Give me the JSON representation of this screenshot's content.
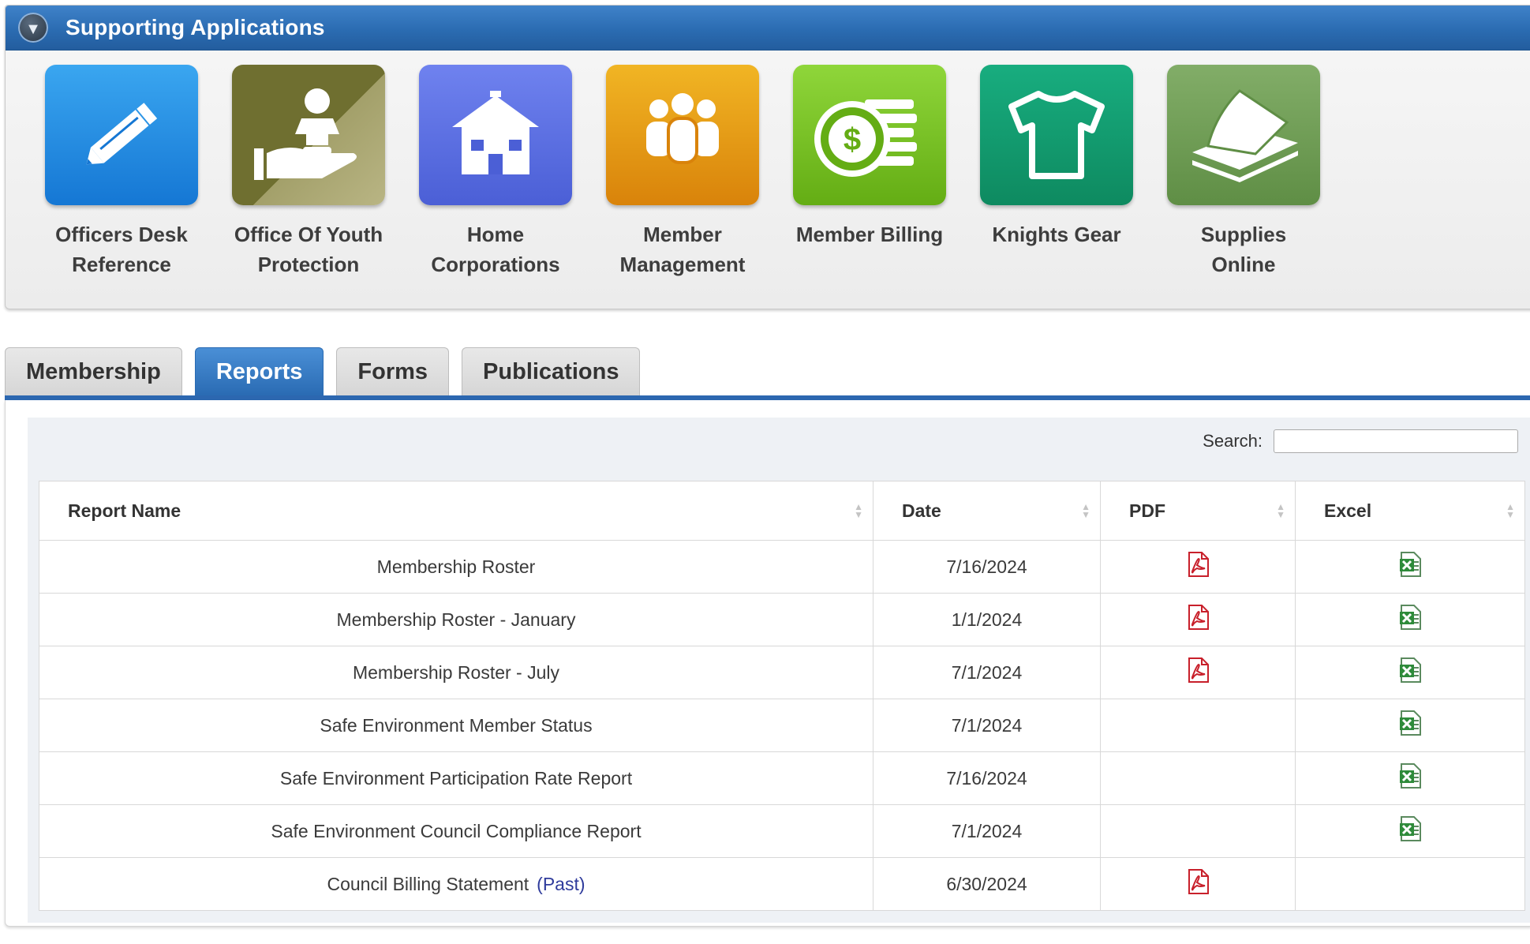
{
  "supporting_apps": {
    "title": "Supporting Applications",
    "apps": [
      {
        "line1": "Officers Desk",
        "line2": "Reference",
        "icon": "pencil-icon",
        "color": "#1e8fe6"
      },
      {
        "line1": "Office Of Youth",
        "line2": "Protection",
        "icon": "child-in-hand-icon",
        "color": "#7a7a3e"
      },
      {
        "line1": "Home",
        "line2": "Corporations",
        "icon": "house-icon",
        "color": "#5b6fe0"
      },
      {
        "line1": "Member",
        "line2": "Management",
        "icon": "people-group-icon",
        "color": "#e2980c"
      },
      {
        "line1": "Member Billing",
        "line2": "",
        "icon": "dollar-coins-icon",
        "color": "#76c11f"
      },
      {
        "line1": "Knights Gear",
        "line2": "",
        "icon": "tshirt-icon",
        "color": "#119a6f"
      },
      {
        "line1": "Supplies",
        "line2": "Online",
        "icon": "paper-stack-icon",
        "color": "#74a25a"
      }
    ]
  },
  "tabs": [
    {
      "label": "Membership",
      "active": false
    },
    {
      "label": "Reports",
      "active": true
    },
    {
      "label": "Forms",
      "active": false
    },
    {
      "label": "Publications",
      "active": false
    }
  ],
  "search": {
    "label": "Search:",
    "value": ""
  },
  "table": {
    "headers": {
      "name": "Report Name",
      "date": "Date",
      "pdf": "PDF",
      "excel": "Excel"
    },
    "rows": [
      {
        "name": "Membership Roster",
        "suffix": "",
        "date": "7/16/2024",
        "pdf": true,
        "excel": true
      },
      {
        "name": "Membership Roster - January",
        "suffix": "",
        "date": "1/1/2024",
        "pdf": true,
        "excel": true
      },
      {
        "name": "Membership Roster - July",
        "suffix": "",
        "date": "7/1/2024",
        "pdf": true,
        "excel": true
      },
      {
        "name": "Safe Environment Member Status",
        "suffix": "",
        "date": "7/1/2024",
        "pdf": false,
        "excel": true
      },
      {
        "name": "Safe Environment Participation Rate Report",
        "suffix": "",
        "date": "7/16/2024",
        "pdf": false,
        "excel": true
      },
      {
        "name": "Safe Environment Council Compliance Report",
        "suffix": "",
        "date": "7/1/2024",
        "pdf": false,
        "excel": true
      },
      {
        "name": "Council Billing Statement",
        "suffix": "(Past)",
        "date": "6/30/2024",
        "pdf": true,
        "excel": false
      }
    ]
  },
  "colors": {
    "header_blue": "#2b6cb2",
    "tab_active": "#3a7dc6",
    "pdf_red": "#c8202b",
    "excel_green": "#2e8b3a"
  }
}
